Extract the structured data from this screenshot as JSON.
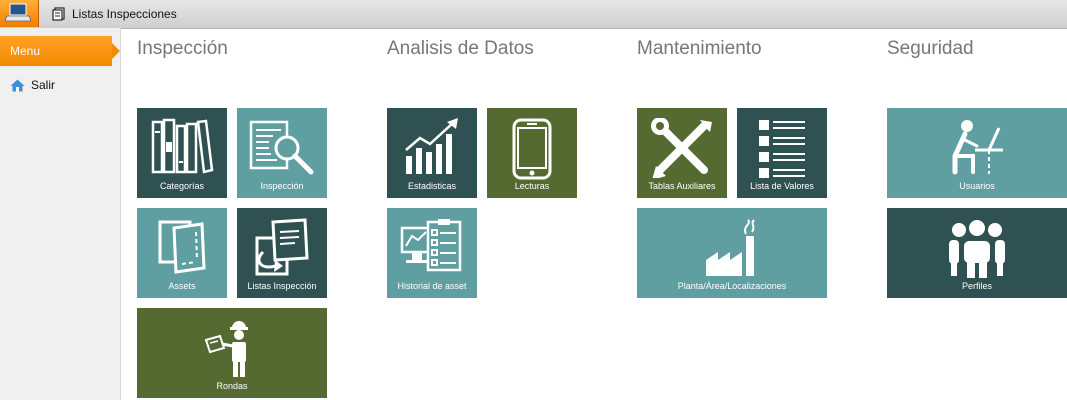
{
  "tab": {
    "title": "Listas Inspecciones"
  },
  "sidebar": {
    "menu_label": "Menu",
    "salir_label": "Salir"
  },
  "sections": {
    "inspeccion": "Inspección",
    "analisis": "Analisis de Datos",
    "mantenimiento": "Mantenimiento",
    "seguridad": "Seguridad"
  },
  "tiles": {
    "categorias": "Categorías",
    "inspeccion": "Inspección",
    "assets": "Assets",
    "listas": "Listas Inspección",
    "rondas": "Rondas",
    "estadisticas": "Estadisticas",
    "lecturas": "Lecturas",
    "historial": "Historial de asset",
    "tablas": "Tablas Auxiliares",
    "lista_valores": "Lista de Valores",
    "planta": "Planta/Área/Localizaciones",
    "usuarios": "Usuarios",
    "perfiles": "Perfiles"
  },
  "colors": {
    "dark": "#2f5151",
    "teal": "#5f9fa2",
    "olive": "#546a31",
    "accent": "#f28a00"
  }
}
